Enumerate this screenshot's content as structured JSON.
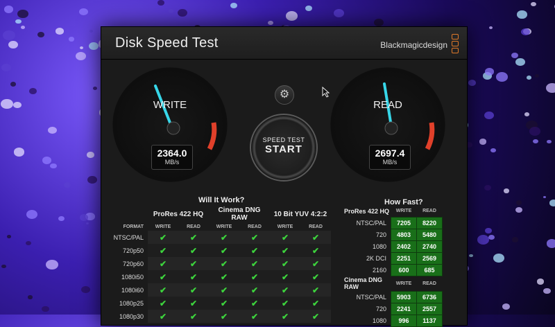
{
  "window": {
    "title": "Disk Speed Test",
    "brand": "Blackmagicdesign"
  },
  "gauges": {
    "write": {
      "label": "WRITE",
      "value": "2364.0",
      "unit": "MB/s"
    },
    "read": {
      "label": "READ",
      "value": "2697.4",
      "unit": "MB/s"
    }
  },
  "start_button": {
    "line1": "SPEED TEST",
    "line2": "START"
  },
  "will_it_work": {
    "title": "Will It Work?",
    "format_header": "FORMAT",
    "codecs": [
      "ProRes 422 HQ",
      "Cinema DNG RAW",
      "10 Bit YUV 4:2:2"
    ],
    "sub_headers": [
      "WRITE",
      "READ"
    ],
    "rows": [
      "NTSC/PAL",
      "720p50",
      "720p60",
      "1080i50",
      "1080i60",
      "1080p25",
      "1080p30"
    ],
    "check_glyph": "✔"
  },
  "how_fast": {
    "title": "How Fast?",
    "sub_headers": [
      "WRITE",
      "READ"
    ],
    "groups": [
      {
        "name": "ProRes 422 HQ",
        "rows": [
          {
            "label": "NTSC/PAL",
            "write": "7205",
            "read": "8220"
          },
          {
            "label": "720",
            "write": "4803",
            "read": "5480"
          },
          {
            "label": "1080",
            "write": "2402",
            "read": "2740"
          },
          {
            "label": "2K DCI",
            "write": "2251",
            "read": "2569"
          },
          {
            "label": "2160",
            "write": "600",
            "read": "685"
          }
        ]
      },
      {
        "name": "Cinema DNG RAW",
        "rows": [
          {
            "label": "NTSC/PAL",
            "write": "5903",
            "read": "6736"
          },
          {
            "label": "720",
            "write": "2241",
            "read": "2557"
          },
          {
            "label": "1080",
            "write": "996",
            "read": "1137"
          }
        ]
      }
    ]
  },
  "colors": {
    "needle": "#37d6e8",
    "redline": "#e0402a",
    "check": "#3dd43d",
    "cell_green": "#196f19",
    "brand_accent": "#e07a2a"
  }
}
